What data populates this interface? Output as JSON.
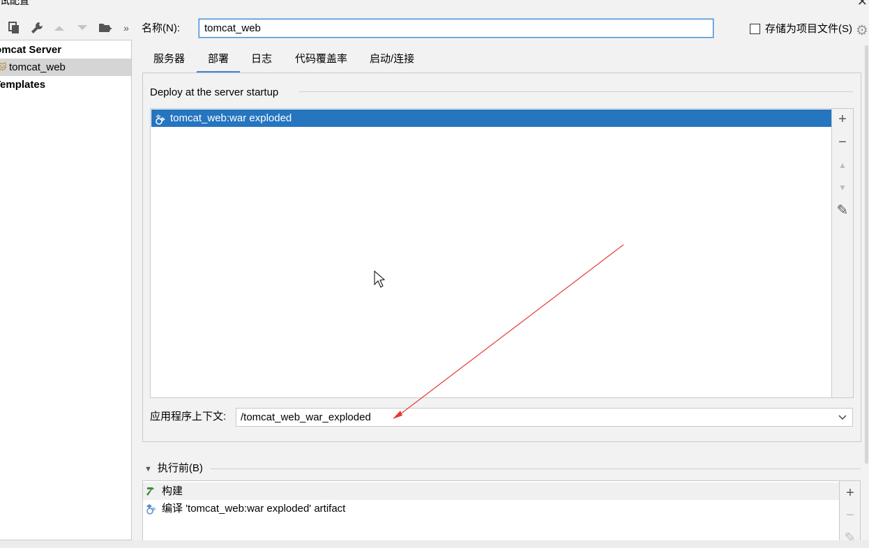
{
  "window": {
    "title": "调试配置",
    "close": "✕"
  },
  "toolbar": {
    "icons": [
      "copy-icon",
      "wrench-icon",
      "move-up-icon",
      "move-down-icon",
      "new-folder-icon",
      "more-icon"
    ],
    "more": "»"
  },
  "tree": {
    "items": [
      {
        "label": "Tomcat Server",
        "bold": true
      },
      {
        "label": "tomcat_web",
        "selected": true,
        "icon": "tomcat-icon"
      },
      {
        "label": "Templates",
        "bold": true
      }
    ]
  },
  "name_field": {
    "label": "名称(N):",
    "value": "tomcat_web"
  },
  "store_as_project": {
    "label": "存储为项目文件(S)",
    "checked": false
  },
  "tabs": [
    {
      "label": "服务器",
      "active": false
    },
    {
      "label": "部署",
      "active": true
    },
    {
      "label": "日志",
      "active": false
    },
    {
      "label": "代码覆盖率",
      "active": false
    },
    {
      "label": "启动/连接",
      "active": false
    }
  ],
  "deploy": {
    "section_title": "Deploy at the server startup",
    "items": [
      {
        "label": "tomcat_web:war exploded",
        "selected": true,
        "icon": "artifact-icon"
      }
    ],
    "side_buttons": [
      {
        "icon": "add-icon",
        "glyph": "+",
        "enabled": true
      },
      {
        "icon": "remove-icon",
        "glyph": "−",
        "enabled": true
      },
      {
        "icon": "move-up-icon",
        "glyph": "▲",
        "enabled": false
      },
      {
        "icon": "move-down-icon",
        "glyph": "▼",
        "enabled": false
      },
      {
        "icon": "edit-icon",
        "glyph": "✎",
        "enabled": true
      }
    ]
  },
  "context": {
    "label": "应用程序上下文:",
    "value": "/tomcat_web_war_exploded"
  },
  "before_launch": {
    "header": "执行前(B)",
    "items": [
      {
        "label": "构建",
        "icon": "build-hammer-icon"
      },
      {
        "label": "编译 'tomcat_web:war exploded' artifact",
        "icon": "artifact-icon"
      }
    ],
    "side_buttons": [
      {
        "icon": "add-icon",
        "glyph": "+",
        "enabled": true
      },
      {
        "icon": "remove-icon",
        "glyph": "−",
        "enabled": false
      },
      {
        "icon": "edit-icon",
        "glyph": "✎",
        "enabled": false
      }
    ]
  },
  "colors": {
    "accent": "#3c86d3",
    "selection": "#2675bf",
    "annotation_arrow": "#e53935"
  }
}
